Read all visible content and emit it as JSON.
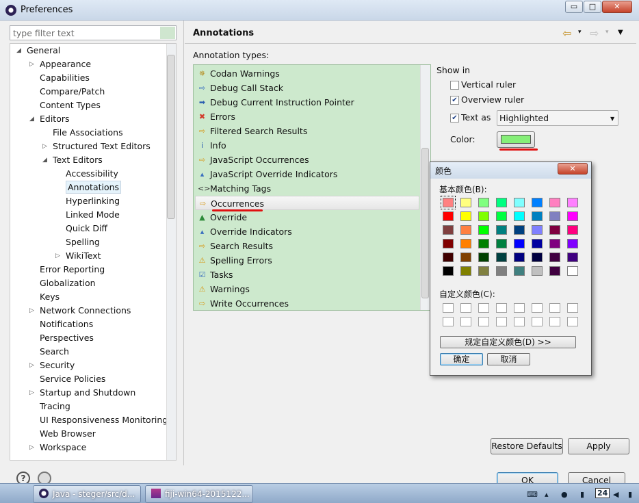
{
  "window": {
    "title": "Preferences",
    "controls": {
      "minimize": "▭",
      "maximize": "□",
      "close": "✕"
    }
  },
  "filter": {
    "placeholder": "type filter text"
  },
  "tree": [
    {
      "label": "General",
      "level": 0,
      "expander": "◢"
    },
    {
      "label": "Appearance",
      "level": 1,
      "expander": "▷"
    },
    {
      "label": "Capabilities",
      "level": 1,
      "expander": ""
    },
    {
      "label": "Compare/Patch",
      "level": 1,
      "expander": ""
    },
    {
      "label": "Content Types",
      "level": 1,
      "expander": ""
    },
    {
      "label": "Editors",
      "level": 1,
      "expander": "◢"
    },
    {
      "label": "File Associations",
      "level": 2,
      "expander": ""
    },
    {
      "label": "Structured Text Editors",
      "level": 2,
      "expander": "▷"
    },
    {
      "label": "Text Editors",
      "level": 2,
      "expander": "◢"
    },
    {
      "label": "Accessibility",
      "level": 3,
      "expander": ""
    },
    {
      "label": "Annotations",
      "level": 3,
      "expander": "",
      "selected": true
    },
    {
      "label": "Hyperlinking",
      "level": 3,
      "expander": ""
    },
    {
      "label": "Linked Mode",
      "level": 3,
      "expander": ""
    },
    {
      "label": "Quick Diff",
      "level": 3,
      "expander": ""
    },
    {
      "label": "Spelling",
      "level": 3,
      "expander": ""
    },
    {
      "label": "WikiText",
      "level": 3,
      "expander": "▷"
    },
    {
      "label": "Error Reporting",
      "level": 1,
      "expander": ""
    },
    {
      "label": "Globalization",
      "level": 1,
      "expander": ""
    },
    {
      "label": "Keys",
      "level": 1,
      "expander": ""
    },
    {
      "label": "Network Connections",
      "level": 1,
      "expander": "▷"
    },
    {
      "label": "Notifications",
      "level": 1,
      "expander": ""
    },
    {
      "label": "Perspectives",
      "level": 1,
      "expander": ""
    },
    {
      "label": "Search",
      "level": 1,
      "expander": ""
    },
    {
      "label": "Security",
      "level": 1,
      "expander": "▷"
    },
    {
      "label": "Service Policies",
      "level": 1,
      "expander": ""
    },
    {
      "label": "Startup and Shutdown",
      "level": 1,
      "expander": "▷"
    },
    {
      "label": "Tracing",
      "level": 1,
      "expander": ""
    },
    {
      "label": "UI Responsiveness Monitoring",
      "level": 1,
      "expander": ""
    },
    {
      "label": "Web Browser",
      "level": 1,
      "expander": ""
    },
    {
      "label": "Workspace",
      "level": 1,
      "expander": "▷"
    }
  ],
  "page": {
    "title": "Annotations",
    "nav": {
      "back": "⇦",
      "forward": "⇨",
      "dropdown": "▾",
      "menu": "▼"
    },
    "types_label": "Annotation types:",
    "annotation_types": [
      {
        "label": "Codan Warnings",
        "icon": "✵",
        "icon_color": "#b58a1c"
      },
      {
        "label": "Debug Call Stack",
        "icon": "⇨",
        "icon_color": "#3a6fbf"
      },
      {
        "label": "Debug Current Instruction Pointer",
        "icon": "➡",
        "icon_color": "#2a5db0"
      },
      {
        "label": "Errors",
        "icon": "✖",
        "icon_color": "#d23b2b"
      },
      {
        "label": "Filtered Search Results",
        "icon": "⇨",
        "icon_color": "#d69a1a"
      },
      {
        "label": "Info",
        "icon": "i",
        "icon_color": "#2a5db0"
      },
      {
        "label": "JavaScript Occurrences",
        "icon": "⇨",
        "icon_color": "#d69a1a"
      },
      {
        "label": "JavaScript Override Indicators",
        "icon": "▴",
        "icon_color": "#3a6fbf"
      },
      {
        "label": "Matching Tags",
        "icon": "<>",
        "icon_color": "#333333"
      },
      {
        "label": "Occurrences",
        "icon": "⇨",
        "icon_color": "#d69a1a",
        "selected": true
      },
      {
        "label": "Override",
        "icon": "▲",
        "icon_color": "#2e8b3a"
      },
      {
        "label": "Override Indicators",
        "icon": "▴",
        "icon_color": "#3a6fbf"
      },
      {
        "label": "Search Results",
        "icon": "⇨",
        "icon_color": "#d69a1a"
      },
      {
        "label": "Spelling Errors",
        "icon": "⚠",
        "icon_color": "#d69a1a"
      },
      {
        "label": "Tasks",
        "icon": "☑",
        "icon_color": "#3a6fbf"
      },
      {
        "label": "Warnings",
        "icon": "⚠",
        "icon_color": "#d69a1a"
      },
      {
        "label": "Write Occurrences",
        "icon": "⇨",
        "icon_color": "#d69a1a"
      }
    ],
    "show_in": "Show in",
    "vertical_ruler": {
      "label": "Vertical ruler",
      "checked": false
    },
    "overview_ruler": {
      "label": "Overview ruler",
      "checked": true
    },
    "text_as": {
      "label": "Text as",
      "checked": true,
      "value": "Highlighted"
    },
    "color": {
      "label": "Color:",
      "value": "#86ef78"
    },
    "restore_defaults": "Restore Defaults",
    "apply": "Apply"
  },
  "footer": {
    "ok": "OK",
    "cancel": "Cancel",
    "help": "?"
  },
  "color_dialog": {
    "title": "颜色",
    "close": "✕",
    "basic_label": "基本颜色(B):",
    "basic_colors": [
      "#ff8080",
      "#ffff80",
      "#80ff80",
      "#00ff80",
      "#80ffff",
      "#0080ff",
      "#ff80c0",
      "#ff80ff",
      "#ff0000",
      "#ffff00",
      "#80ff00",
      "#00ff40",
      "#00ffff",
      "#0080c0",
      "#8080c0",
      "#ff00ff",
      "#804040",
      "#ff8040",
      "#00ff00",
      "#008080",
      "#004080",
      "#8080ff",
      "#800040",
      "#ff0080",
      "#800000",
      "#ff8000",
      "#008000",
      "#008040",
      "#0000ff",
      "#0000a0",
      "#800080",
      "#8000ff",
      "#400000",
      "#804000",
      "#004000",
      "#004040",
      "#000080",
      "#000040",
      "#400040",
      "#400080",
      "#000000",
      "#808000",
      "#808040",
      "#808080",
      "#408080",
      "#c0c0c0",
      "#400040",
      "#ffffff"
    ],
    "custom_label": "自定义颜色(C):",
    "define_button": "规定自定义颜色(D) >>",
    "ok": "确定",
    "cancel": "取消"
  },
  "taskbar": {
    "items": [
      {
        "label": "Java - steger/src/d..."
      },
      {
        "label": "fiji-win64-2015122..."
      }
    ],
    "tray_date": "24"
  }
}
